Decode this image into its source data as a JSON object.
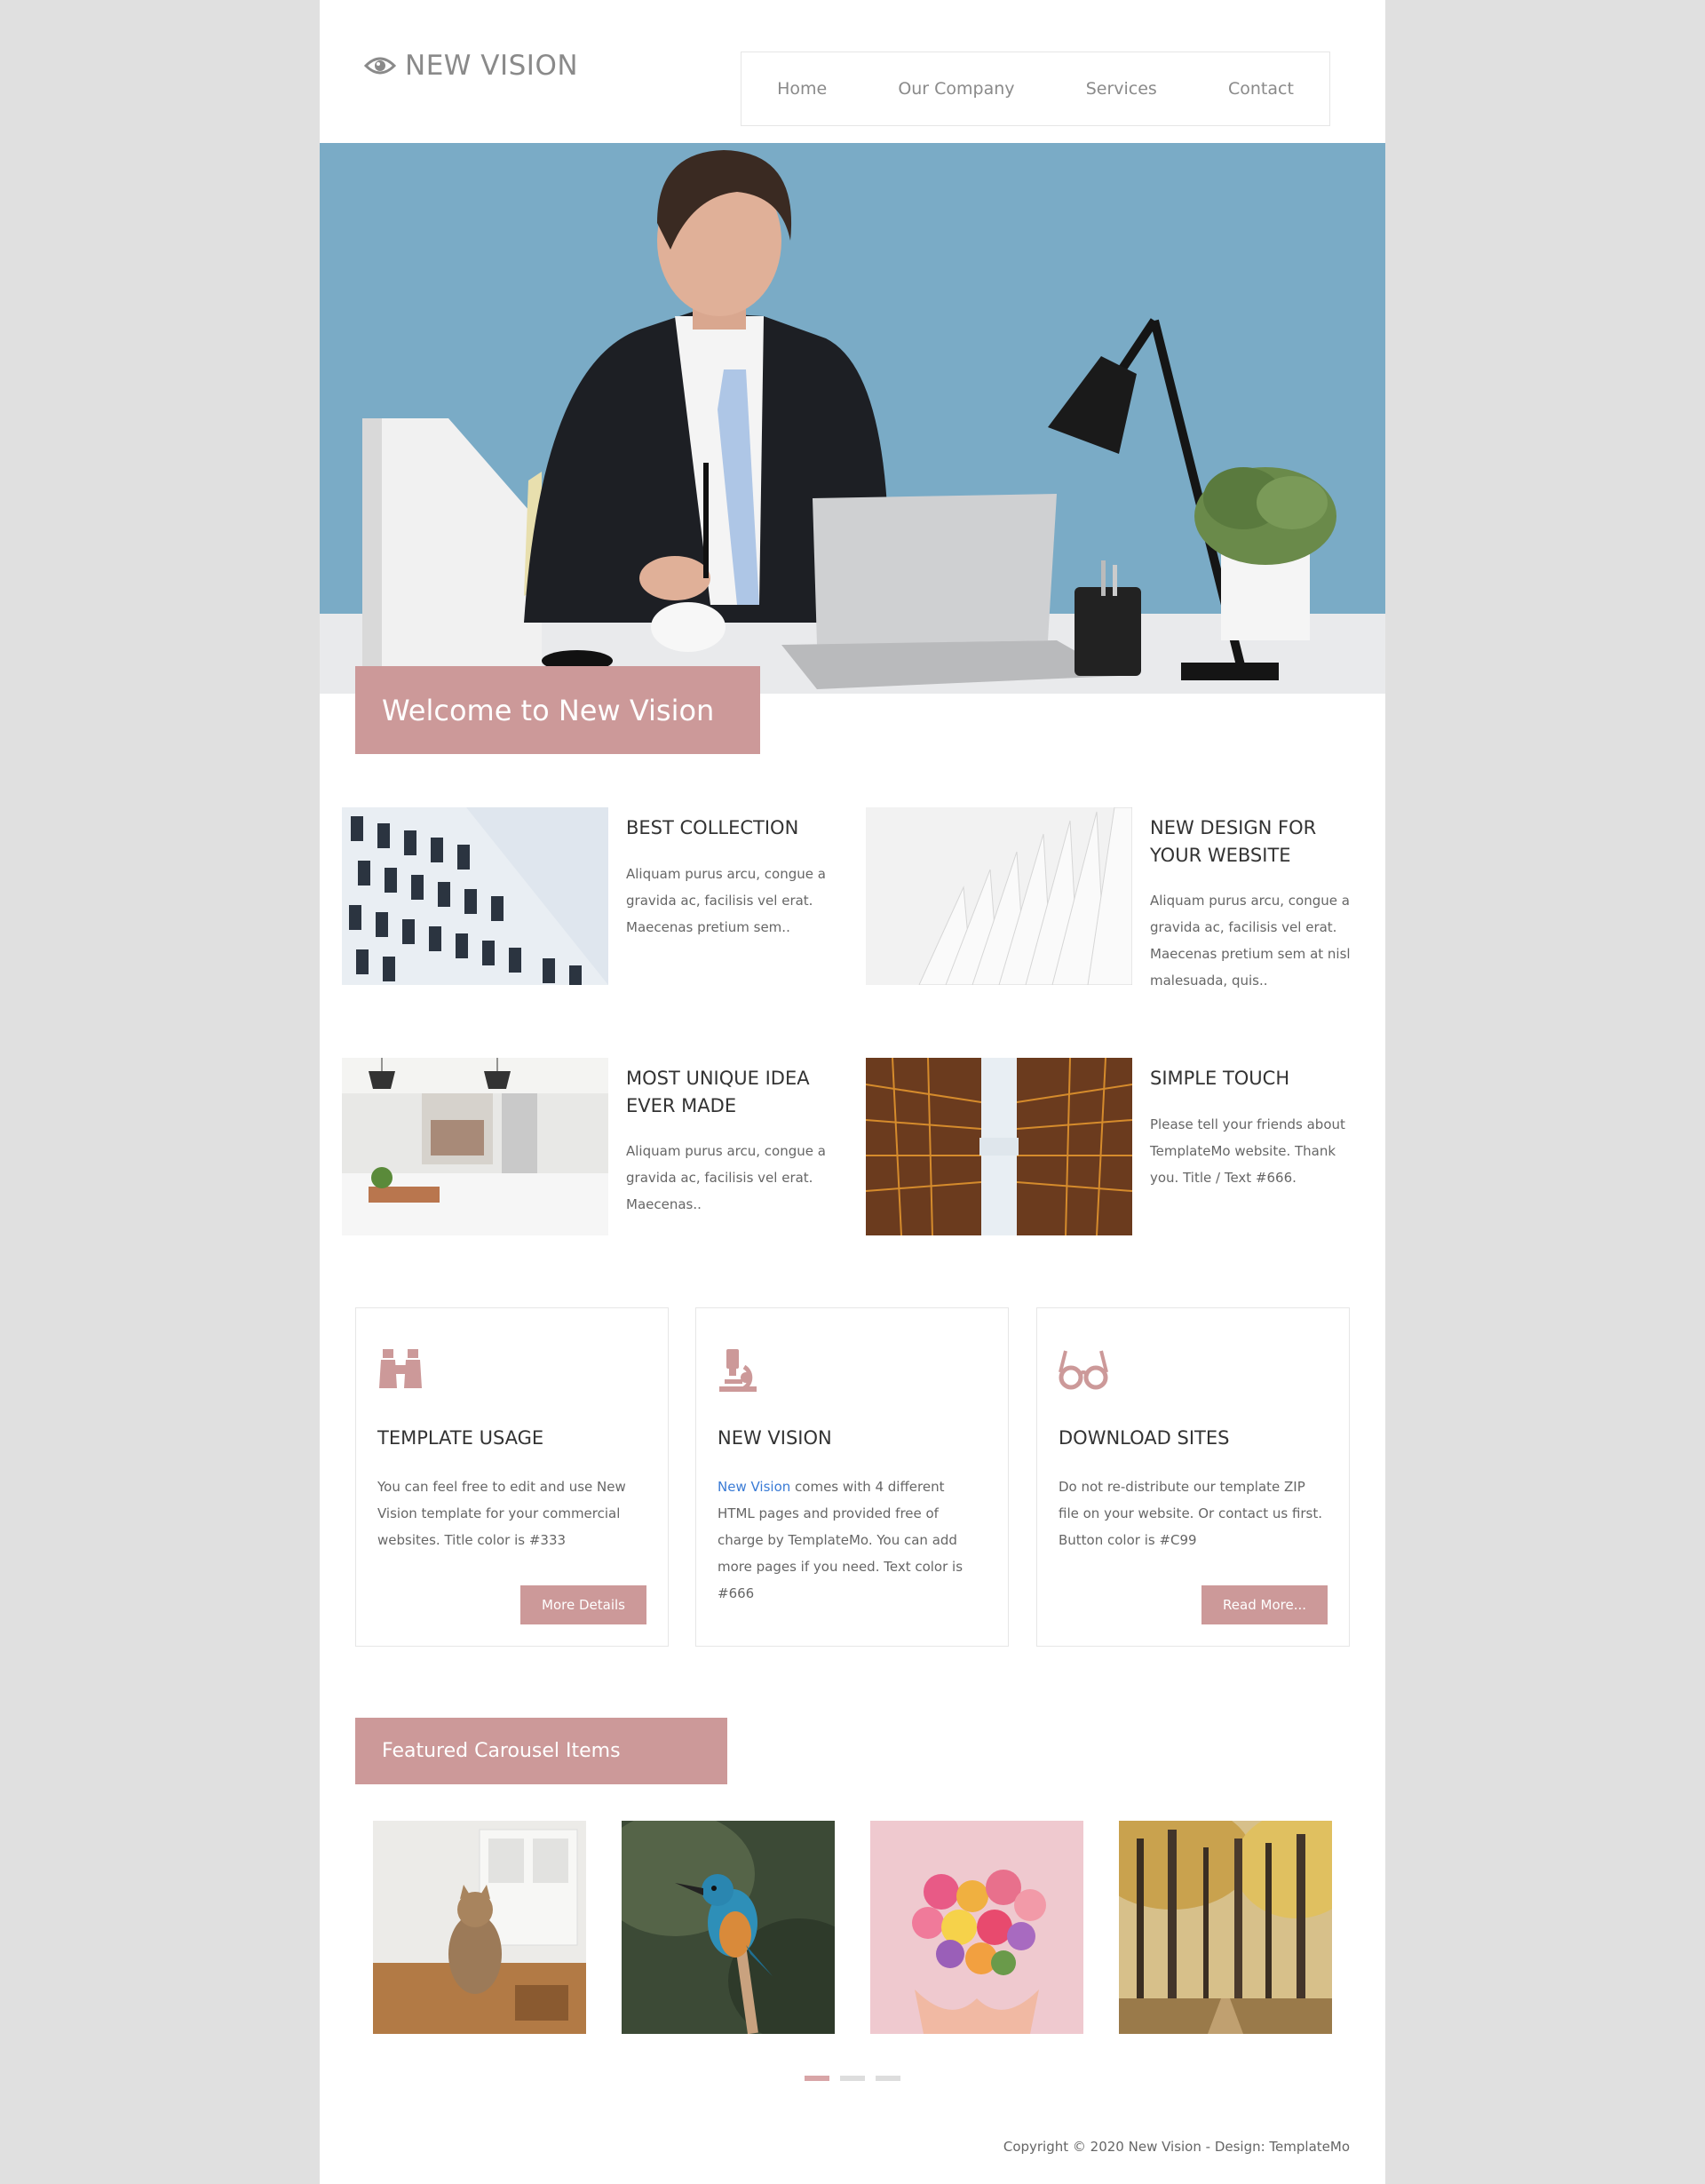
{
  "brand": {
    "name": "NEW VISION",
    "icon": "eye-icon"
  },
  "nav": [
    {
      "label": "Home"
    },
    {
      "label": "Our Company"
    },
    {
      "label": "Services"
    },
    {
      "label": "Contact"
    }
  ],
  "hero": {
    "welcome": "Welcome to New Vision"
  },
  "features": [
    {
      "title": "BEST COLLECTION",
      "text": "Aliquam purus arcu, congue a gravida ac, facilisis vel erat. Maecenas pretium sem.."
    },
    {
      "title": "NEW DESIGN FOR YOUR WEBSITE",
      "text": "Aliquam purus arcu, congue a gravida ac, facilisis vel erat. Maecenas pretium sem at nisl malesuada, quis.."
    },
    {
      "title": "MOST UNIQUE IDEA EVER MADE",
      "text": "Aliquam purus arcu, congue a gravida ac, facilisis vel erat. Maecenas.."
    },
    {
      "title": "SIMPLE TOUCH",
      "text": "Please tell your friends about TemplateMo website. Thank you. Title / Text #666."
    }
  ],
  "cards": [
    {
      "icon": "binoculars-icon",
      "title": "TEMPLATE USAGE",
      "text": "You can feel free to edit and use New Vision template for your commercial websites. Title color is #333",
      "button": "More Details"
    },
    {
      "icon": "microscope-icon",
      "title": "NEW VISION",
      "link": "New Vision",
      "text": " comes with 4 different HTML pages and provided free of charge by TemplateMo. You can add more pages if you need. Text color is #666"
    },
    {
      "icon": "glasses-icon",
      "title": "DOWNLOAD SITES",
      "text": "Do not re-distribute our template ZIP file on your website. Or contact us first. Button color is #C99",
      "button": "Read More..."
    }
  ],
  "carousel": {
    "title": "Featured Carousel Items",
    "items": [
      "cat-photo",
      "kingfisher-photo",
      "flower-heart-photo",
      "autumn-forest-photo"
    ]
  },
  "footer": {
    "copyright": "Copyright © 2020 New Vision - Design: TemplateMo"
  },
  "colors": {
    "accent": "#c99",
    "title": "#333",
    "text": "#666",
    "link": "#3a7bd5"
  }
}
